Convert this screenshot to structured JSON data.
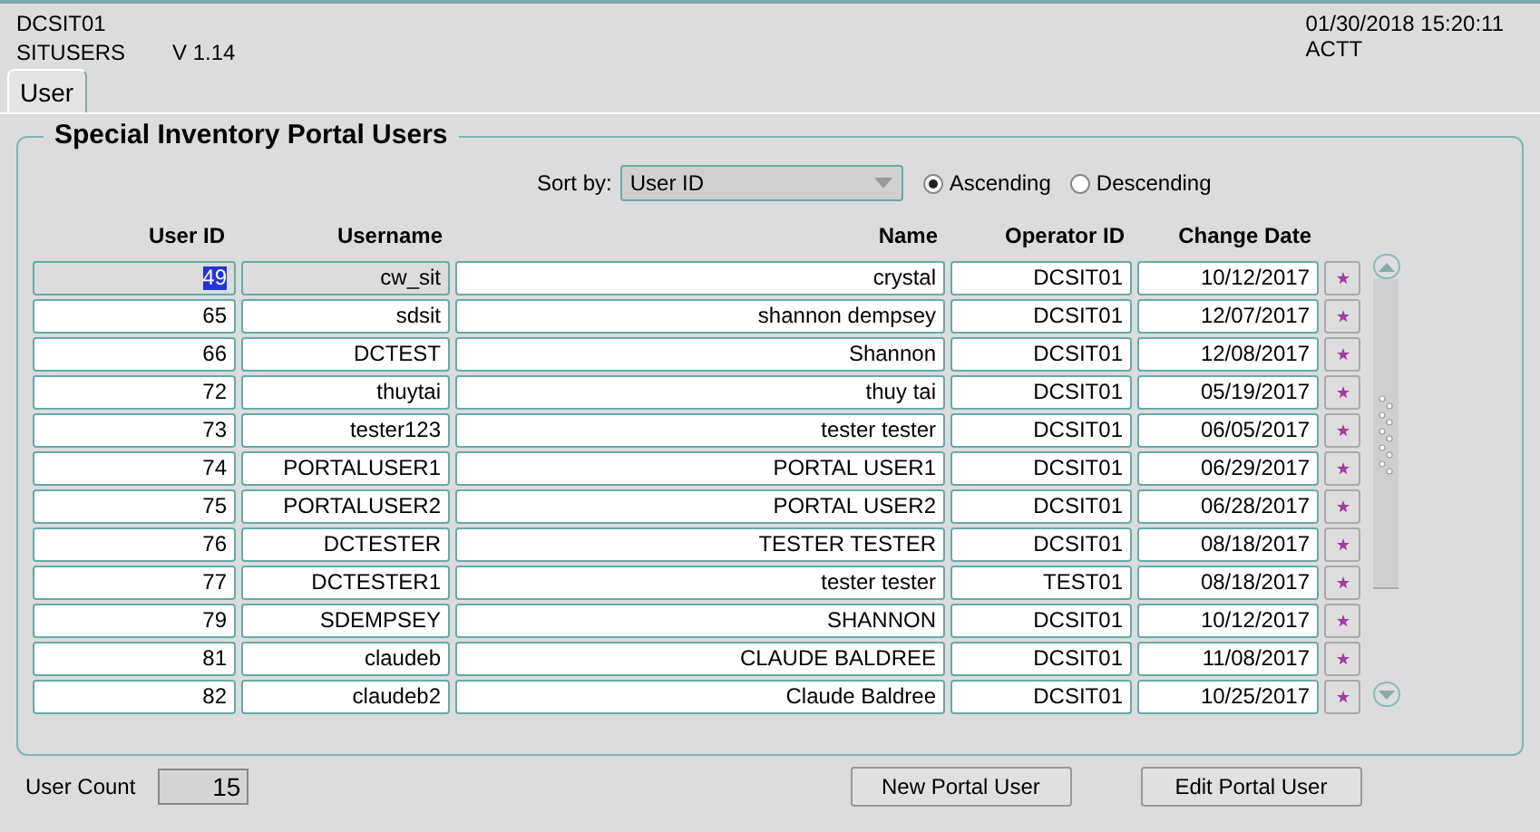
{
  "header": {
    "app_code": "DCSIT01",
    "module": "SITUSERS",
    "version": "V 1.14",
    "datetime": "01/30/2018 15:20:11",
    "user": "ACTT"
  },
  "tabs": [
    {
      "label": "User",
      "selected": true
    }
  ],
  "panel": {
    "title": "Special Inventory Portal Users",
    "sort": {
      "label": "Sort by:",
      "value": "User ID",
      "options": [
        {
          "label": "Ascending",
          "selected": true
        },
        {
          "label": "Descending",
          "selected": false
        }
      ]
    },
    "columns": [
      "User ID",
      "Username",
      "Name",
      "Operator ID",
      "Change Date"
    ],
    "rows": [
      {
        "user_id": "49",
        "username": "cw_sit",
        "name": "crystal",
        "operator_id": "DCSIT01",
        "change_date": "10/12/2017",
        "selected": true
      },
      {
        "user_id": "65",
        "username": "sdsit",
        "name": "shannon dempsey",
        "operator_id": "DCSIT01",
        "change_date": "12/07/2017",
        "selected": false
      },
      {
        "user_id": "66",
        "username": "DCTEST",
        "name": "Shannon",
        "operator_id": "DCSIT01",
        "change_date": "12/08/2017",
        "selected": false
      },
      {
        "user_id": "72",
        "username": "thuytai",
        "name": "thuy tai",
        "operator_id": "DCSIT01",
        "change_date": "05/19/2017",
        "selected": false
      },
      {
        "user_id": "73",
        "username": "tester123",
        "name": "tester tester",
        "operator_id": "DCSIT01",
        "change_date": "06/05/2017",
        "selected": false
      },
      {
        "user_id": "74",
        "username": "PORTALUSER1",
        "name": "PORTAL USER1",
        "operator_id": "DCSIT01",
        "change_date": "06/29/2017",
        "selected": false
      },
      {
        "user_id": "75",
        "username": "PORTALUSER2",
        "name": "PORTAL USER2",
        "operator_id": "DCSIT01",
        "change_date": "06/28/2017",
        "selected": false
      },
      {
        "user_id": "76",
        "username": "DCTESTER",
        "name": "TESTER TESTER",
        "operator_id": "DCSIT01",
        "change_date": "08/18/2017",
        "selected": false
      },
      {
        "user_id": "77",
        "username": "DCTESTER1",
        "name": "tester tester",
        "operator_id": "TEST01",
        "change_date": "08/18/2017",
        "selected": false
      },
      {
        "user_id": "79",
        "username": "SDEMPSEY",
        "name": "SHANNON",
        "operator_id": "DCSIT01",
        "change_date": "10/12/2017",
        "selected": false
      },
      {
        "user_id": "81",
        "username": "claudeb",
        "name": "CLAUDE BALDREE",
        "operator_id": "DCSIT01",
        "change_date": "11/08/2017",
        "selected": false
      },
      {
        "user_id": "82",
        "username": "claudeb2",
        "name": "Claude Baldree",
        "operator_id": "DCSIT01",
        "change_date": "10/25/2017",
        "selected": false
      }
    ]
  },
  "footer": {
    "count_label": "User Count",
    "count": "15",
    "buttons": [
      "New Portal User",
      "Edit Portal User"
    ]
  }
}
